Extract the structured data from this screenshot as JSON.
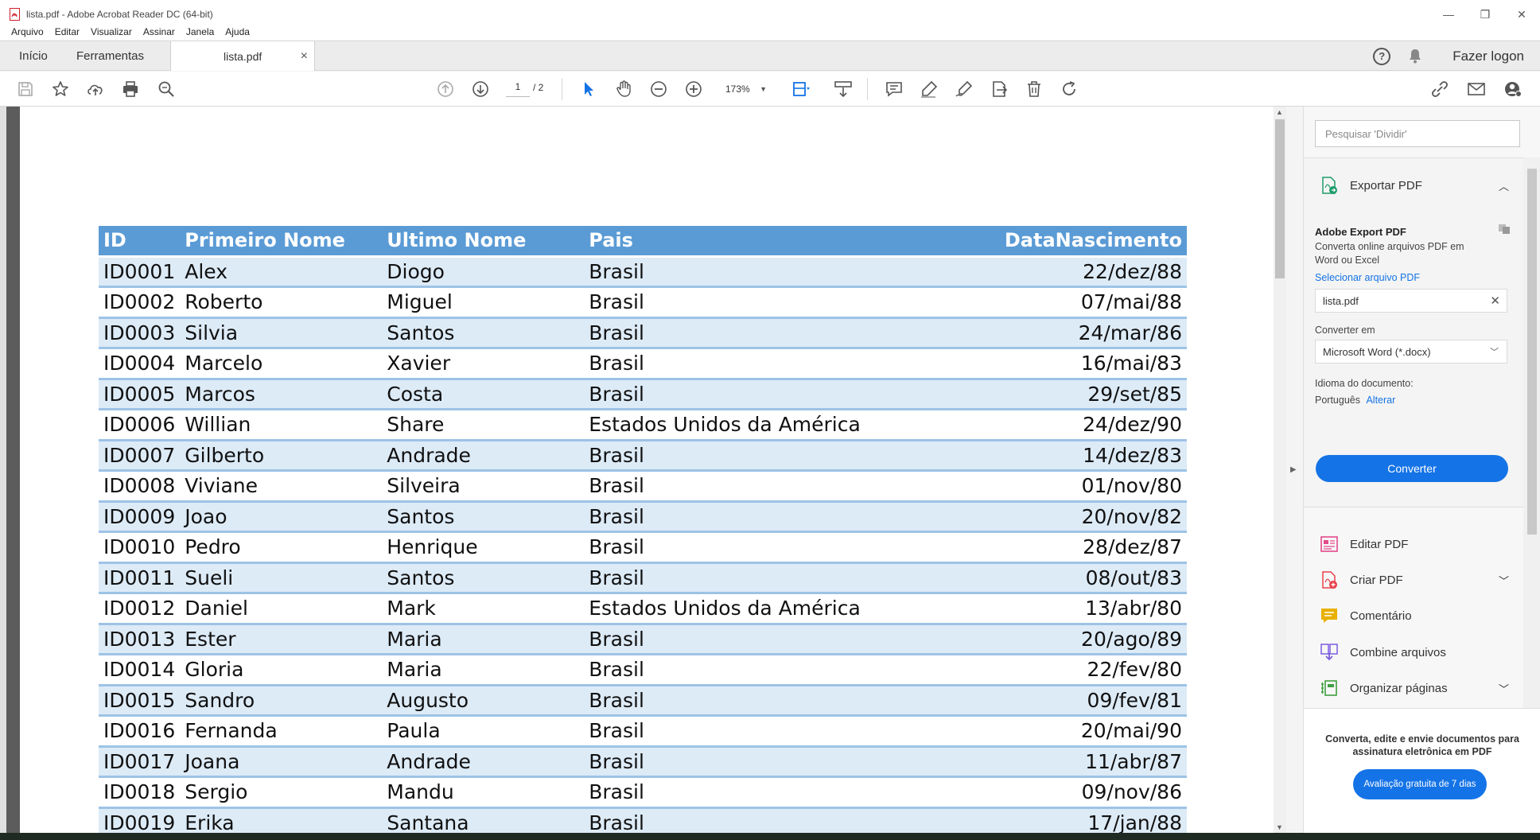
{
  "window": {
    "title": "lista.pdf - Adobe Acrobat Reader DC (64-bit)",
    "minimize": "—",
    "restore": "❐",
    "close": "✕"
  },
  "menu": [
    "Arquivo",
    "Editar",
    "Visualizar",
    "Assinar",
    "Janela",
    "Ajuda"
  ],
  "tabs": {
    "home": "Início",
    "tools": "Ferramentas",
    "document": "lista.pdf",
    "close": "×",
    "login": "Fazer logon",
    "help": "?"
  },
  "toolbar": {
    "page_current": "1",
    "page_total": "/ 2",
    "zoom": "173%"
  },
  "table": {
    "headers": [
      "ID",
      "Primeiro Nome",
      "Ultimo Nome",
      "Pais",
      "DataNascimento"
    ],
    "rows": [
      [
        "ID0001",
        "Alex",
        "Diogo",
        "Brasil",
        "22/dez/88"
      ],
      [
        "ID0002",
        "Roberto",
        "Miguel",
        "Brasil",
        "07/mai/88"
      ],
      [
        "ID0003",
        "Silvia",
        "Santos",
        "Brasil",
        "24/mar/86"
      ],
      [
        "ID0004",
        "Marcelo",
        "Xavier",
        "Brasil",
        "16/mai/83"
      ],
      [
        "ID0005",
        "Marcos",
        "Costa",
        "Brasil",
        "29/set/85"
      ],
      [
        "ID0006",
        "Willian",
        "Share",
        "Estados Unidos da América",
        "24/dez/90"
      ],
      [
        "ID0007",
        "Gilberto",
        "Andrade",
        "Brasil",
        "14/dez/83"
      ],
      [
        "ID0008",
        "Viviane",
        "Silveira",
        "Brasil",
        "01/nov/80"
      ],
      [
        "ID0009",
        "Joao",
        "Santos",
        "Brasil",
        "20/nov/82"
      ],
      [
        "ID0010",
        "Pedro",
        "Henrique",
        "Brasil",
        "28/dez/87"
      ],
      [
        "ID0011",
        "Sueli",
        "Santos",
        "Brasil",
        "08/out/83"
      ],
      [
        "ID0012",
        "Daniel",
        "Mark",
        "Estados Unidos da América",
        "13/abr/80"
      ],
      [
        "ID0013",
        "Ester",
        "Maria",
        "Brasil",
        "20/ago/89"
      ],
      [
        "ID0014",
        "Gloria",
        "Maria",
        "Brasil",
        "22/fev/80"
      ],
      [
        "ID0015",
        "Sandro",
        "Augusto",
        "Brasil",
        "09/fev/81"
      ],
      [
        "ID0016",
        "Fernanda",
        "Paula",
        "Brasil",
        "20/mai/90"
      ],
      [
        "ID0017",
        "Joana",
        "Andrade",
        "Brasil",
        "11/abr/87"
      ],
      [
        "ID0018",
        "Sergio",
        "Mandu",
        "Brasil",
        "09/nov/86"
      ],
      [
        "ID0019",
        "Erika",
        "Santana",
        "Brasil",
        "17/jan/88"
      ]
    ]
  },
  "panel": {
    "search_placeholder": "Pesquisar 'Dividir'",
    "export_title": "Exportar PDF",
    "export_heading": "Adobe Export PDF",
    "export_desc": "Converta online arquivos PDF em Word ou Excel",
    "select_file": "Selecionar arquivo PDF",
    "file_name": "lista.pdf",
    "convert_to_label": "Converter em",
    "convert_to_value": "Microsoft Word (*.docx)",
    "doc_lang_label": "Idioma do documento:",
    "doc_lang_value": "Português",
    "doc_lang_change": "Alterar",
    "convert_button": "Converter",
    "tools": [
      {
        "label": "Editar PDF",
        "icon": "edit-pdf-icon",
        "color": "#e34a8a"
      },
      {
        "label": "Criar PDF",
        "icon": "create-pdf-icon",
        "color": "#e8424a"
      },
      {
        "label": "Comentário",
        "icon": "comment-icon",
        "color": "#e8b000"
      },
      {
        "label": "Combine arquivos",
        "icon": "combine-files-icon",
        "color": "#7b5de0"
      },
      {
        "label": "Organizar páginas",
        "icon": "organize-pages-icon",
        "color": "#3f9f3f"
      }
    ],
    "promo_text": "Converta, edite e envie documentos para assinatura eletrônica em PDF",
    "promo_button": "Avaliação gratuita de 7 dias"
  },
  "colors": {
    "header_blue": "#5b9bd5",
    "row_band": "#ddebf7",
    "accent": "#1473e6"
  }
}
